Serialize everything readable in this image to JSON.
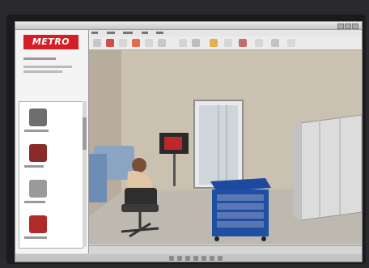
{
  "logo": {
    "text": "METRO"
  },
  "colors": {
    "brand_red": "#d51e26",
    "cart_blue": "#1f4fa3",
    "wall": "#c9bfae",
    "floor": "#b9b5ad"
  },
  "icons": [
    "logo-mark"
  ]
}
